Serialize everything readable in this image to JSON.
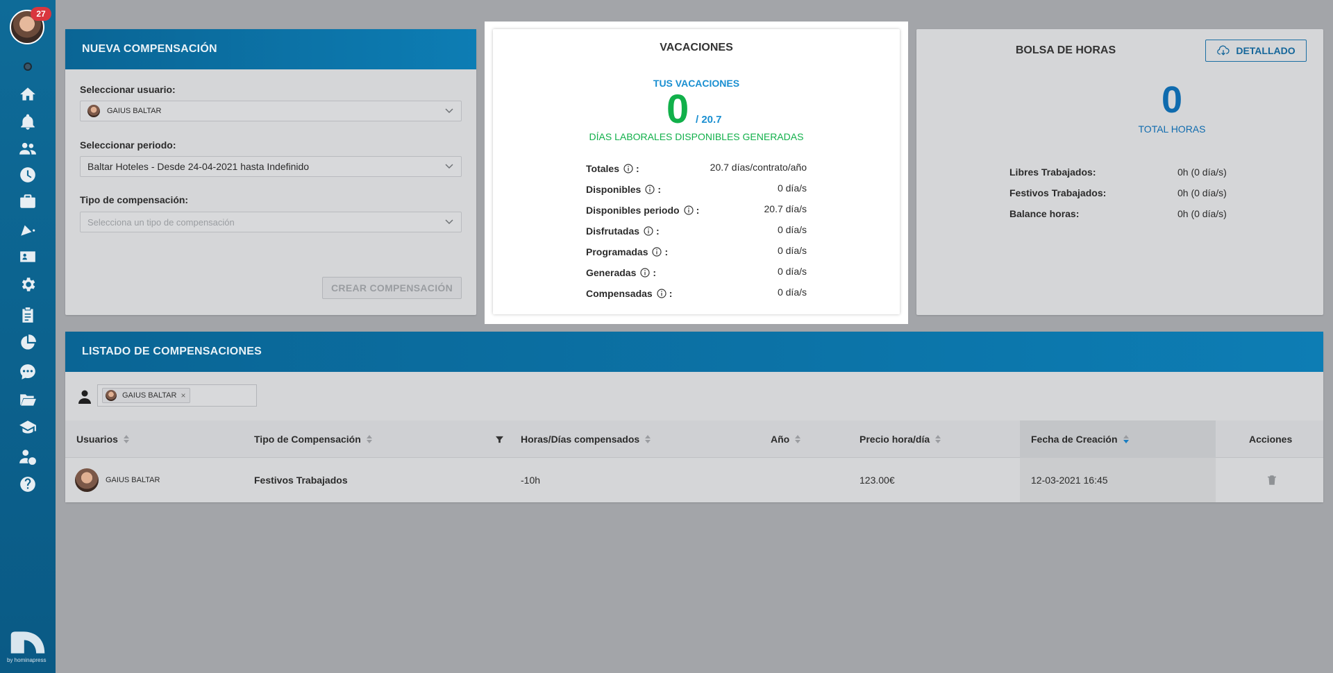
{
  "sidebar": {
    "notification_count": "27",
    "nav_items": [
      {
        "name": "home"
      },
      {
        "name": "notifications"
      },
      {
        "name": "users"
      },
      {
        "name": "clock"
      },
      {
        "name": "briefcase"
      },
      {
        "name": "party"
      },
      {
        "name": "id-card"
      },
      {
        "name": "settings"
      },
      {
        "name": "clipboard"
      },
      {
        "name": "pie-chart"
      },
      {
        "name": "chat"
      },
      {
        "name": "folder"
      },
      {
        "name": "graduation"
      },
      {
        "name": "user-money"
      },
      {
        "name": "help"
      }
    ],
    "brand_by": "by hominapress"
  },
  "nueva": {
    "title": "NUEVA COMPENSACIÓN",
    "usuario_label": "Seleccionar usuario:",
    "usuario_value": "GAIUS BALTAR",
    "periodo_label": "Seleccionar periodo:",
    "periodo_value": "Baltar Hoteles - Desde 24-04-2021 hasta Indefinido",
    "tipo_label": "Tipo de compensación:",
    "tipo_placeholder": "Selecciona un tipo de compensación",
    "crear_button": "CREAR COMPENSACIÓN"
  },
  "vacaciones": {
    "title": "VACACIONES",
    "subtitle": "TUS VACACIONES",
    "big_number": "0",
    "total": "/ 20.7",
    "generated_label": "DÍAS LABORALES DISPONIBLES GENERADAS",
    "rows": [
      {
        "label": "Totales",
        "value": "20.7 días/contrato/año"
      },
      {
        "label": "Disponibles",
        "value": "0 día/s"
      },
      {
        "label": "Disponibles periodo",
        "value": "20.7 día/s"
      },
      {
        "label": "Disfrutadas",
        "value": "0 día/s"
      },
      {
        "label": "Programadas",
        "value": "0 día/s"
      },
      {
        "label": "Generadas",
        "value": "0 día/s"
      },
      {
        "label": "Compensadas",
        "value": "0 día/s"
      }
    ]
  },
  "bolsa": {
    "title": "BOLSA DE HORAS",
    "detallado_button": "DETALLADO",
    "big_number": "0",
    "big_label": "TOTAL HORAS",
    "rows": [
      {
        "label": "Libres Trabajados:",
        "value": "0h (0 día/s)"
      },
      {
        "label": "Festivos Trabajados:",
        "value": "0h (0 día/s)"
      },
      {
        "label": "Balance horas:",
        "value": "0h (0 día/s)"
      }
    ]
  },
  "listado": {
    "title": "LISTADO DE COMPENSACIONES",
    "filter_chip": "GAIUS BALTAR",
    "columns": {
      "usuarios": "Usuarios",
      "tipo": "Tipo de Compensación",
      "horas": "Horas/Días compensados",
      "anio": "Año",
      "precio": "Precio hora/día",
      "fecha": "Fecha de Creación",
      "acciones": "Acciones"
    },
    "rows": [
      {
        "usuario": "GAIUS BALTAR",
        "tipo": "Festivos Trabajados",
        "horas": "-10h",
        "anio": "",
        "precio": "123.00€",
        "fecha": "12-03-2021 16:45"
      }
    ]
  }
}
